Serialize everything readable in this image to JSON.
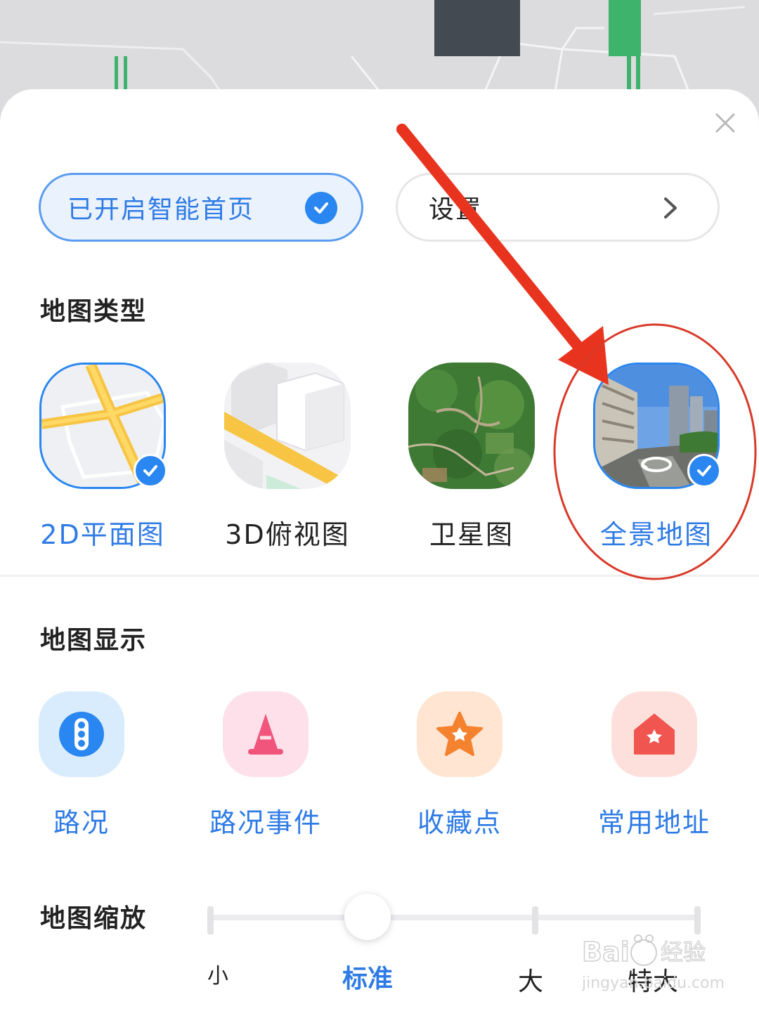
{
  "header": {
    "smart_home_label": "已开启智能首页",
    "settings_label": "设置"
  },
  "map_type": {
    "title": "地图类型",
    "items": [
      {
        "label": "2D平面图",
        "selected": true
      },
      {
        "label": "3D俯视图",
        "selected": false
      },
      {
        "label": "卫星图",
        "selected": false
      },
      {
        "label": "全景地图",
        "selected": true
      }
    ]
  },
  "map_display": {
    "title": "地图显示",
    "items": [
      {
        "label": "路况",
        "icon": "traffic-light-icon",
        "color": "#2a86f0"
      },
      {
        "label": "路况事件",
        "icon": "traffic-cone-icon",
        "color": "#f2557c"
      },
      {
        "label": "收藏点",
        "icon": "star-icon",
        "color": "#f5822f"
      },
      {
        "label": "常用地址",
        "icon": "home-icon",
        "color": "#f0554f"
      }
    ]
  },
  "map_zoom": {
    "title": "地图缩放",
    "levels": [
      "小",
      "标准",
      "大",
      "特大"
    ],
    "selected": "标准"
  },
  "colors": {
    "accent": "#2a86f0",
    "annotation_red": "#e8341f"
  }
}
